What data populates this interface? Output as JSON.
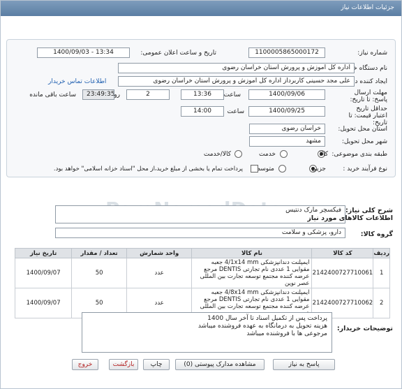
{
  "window_title": "جزئیات اطلاعات نیاز",
  "fields": {
    "need_number_label": "شماره نیاز:",
    "need_number": "1100005865000172",
    "announce_label": "تاریخ و ساعت اعلان عمومی:",
    "announce_value": "1400/09/03 - 13:34",
    "buyer_org_label": "نام دستگاه خریدار:",
    "buyer_org": "اداره کل اموزش و پرورش استان خراسان رضوی",
    "creator_label": "ایجاد کننده درخواست:",
    "creator": "علی مجد حسینی کاربرداز اداره کل اموزش و پرورش استان خراسان رضوی",
    "contact_link": "اطلاعات تماس خریدار",
    "deadline_label": "مهلت ارسال پاسخ: تا تاریخ:",
    "deadline_date": "1400/09/06",
    "time_label": "ساعت",
    "deadline_time": "13:36",
    "days": "2",
    "days_label": "روز و",
    "remaining": "23:49:35",
    "remaining_label": "ساعت باقی مانده",
    "validity_label": "حداقل تاریخ اعتبار قیمت: تا تاریخ:",
    "validity_date": "1400/09/25",
    "validity_time_label": "ساعت",
    "validity_time": "14:00",
    "province_label": "استان محل تحویل:",
    "province": "خراسان رضوی",
    "city_label": "شهر محل تحویل:",
    "city": "مشهد",
    "category_label": "طبقه بندی موضوعی:",
    "category_options": [
      "کالا",
      "خدمت",
      "کالا/خدمت"
    ],
    "process_label": "نوع فرآیند خرید :",
    "process_options": [
      "جزیی",
      "متوسط"
    ],
    "payment_note": "پرداخت تمام یا بخشی از مبلغ خرید،از محل \"اسناد خزانه اسلامی\" خواهد بود."
  },
  "need_desc_label": "شرح کلی نیاز:",
  "need_desc": "فیکسچر مارک دنتیس",
  "goods_info_label": "اطلاعات کالاهای مورد نیاز",
  "goods_group_label": "گروه کالا:",
  "goods_group": "دارو، پزشکی و سلامت",
  "table": {
    "headers": [
      "ردیف",
      "کد کالا",
      "نام کالا",
      "واحد شمارش",
      "تعداد / مقدار",
      "تاریخ نیاز"
    ],
    "rows": [
      {
        "row": "1",
        "code": "2142400727710061",
        "name": "ایمپلنت دندانپزشکی 4/1x14 mm جعبه مقوایی 1 عددی نام تجارتی DENTIS مرجع عرضه کننده مجتمع توسعه تجارت بین المللی عصر نوین",
        "unit": "عدد",
        "qty": "50",
        "date": "1400/09/07"
      },
      {
        "row": "2",
        "code": "2142400727710062",
        "name": "ایمپلنت دندانپزشکی 4/8x14 mm جعبه مقوایی 1 عددی نام تجارتی DENTIS مرجع عرضه کننده مجتمع توسعه تجارت بین المللی عصر نوین",
        "unit": "عدد",
        "qty": "50",
        "date": "1400/09/07"
      }
    ]
  },
  "notes_label": "توضیحات خریدار:",
  "notes": [
    "پرداخت پس از تکمیل اسناد تا آخر سال 1400",
    "هزینه تحویل به درمانگاه به عهده فروشنده میباشد",
    "مرجوعی ها با فروشنده میباشد"
  ],
  "buttons": {
    "reply": "پاسخ به نیاز",
    "attachments": "مشاهده مدارک پیوستی (0)",
    "print": "چاپ",
    "back": "بازگشت",
    "exit": "خروج"
  }
}
